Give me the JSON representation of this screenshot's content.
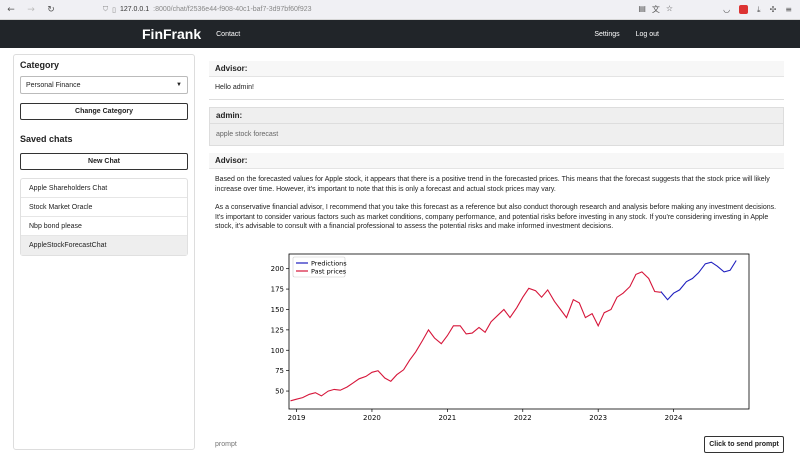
{
  "browser": {
    "url_host": "127.0.0.1",
    "url_rest": ":8000/chat/f2536e44-f908-40c1-baf7-3d97bf60f923"
  },
  "navbar": {
    "brand": "FinFrank",
    "contact": "Contact",
    "settings": "Settings",
    "logout": "Log out"
  },
  "sidebar": {
    "category_title": "Category",
    "category_selected": "Personal Finance",
    "change_category": "Change Category",
    "saved_title": "Saved chats",
    "new_chat": "New Chat",
    "chats": [
      {
        "label": "Apple Shareholders Chat"
      },
      {
        "label": "Stock Market Oracle"
      },
      {
        "label": "Nbp bond please"
      },
      {
        "label": "AppleStockForecastChat"
      }
    ]
  },
  "messages": {
    "m1": {
      "sender": "Advisor:",
      "text": "Hello admin!"
    },
    "m2": {
      "sender": "admin:",
      "text": "apple stock forecast"
    },
    "m3": {
      "sender": "Advisor:",
      "p1": "Based on the forecasted values for Apple stock, it appears that there is a positive trend in the forecasted prices. This means that the forecast suggests that the stock price will likely increase over time. However, it's important to note that this is only a forecast and actual stock prices may vary.",
      "p2": "As a conservative financial advisor, I recommend that you take this forecast as a reference but also conduct thorough research and analysis before making any investment decisions. It's important to consider various factors such as market conditions, company performance, and potential risks before investing in any stock. If you're considering investing in Apple stock, it's advisable to consult with a financial professional to assess the potential risks and make informed investment decisions."
    }
  },
  "input": {
    "placeholder": "prompt",
    "send_label": "Click to send prompt"
  },
  "chart_data": {
    "type": "line",
    "xlim": [
      2018.9,
      2025.0
    ],
    "ylim": [
      28,
      218
    ],
    "yticks": [
      50,
      75,
      100,
      125,
      150,
      175,
      200
    ],
    "xticks": [
      2019,
      2020,
      2021,
      2022,
      2023,
      2024
    ],
    "legend_position": "top-left",
    "series": [
      {
        "name": "Predictions",
        "color": "#1f1fbf",
        "x": [
          2023.83,
          2023.92,
          2024.0,
          2024.08,
          2024.17,
          2024.25,
          2024.33,
          2024.42,
          2024.5,
          2024.58,
          2024.67,
          2024.75,
          2024.83
        ],
        "y": [
          172,
          162,
          170,
          174,
          184,
          188,
          195,
          206,
          208,
          203,
          196,
          198,
          210
        ]
      },
      {
        "name": "Past prices",
        "color": "#d6163a",
        "x": [
          2018.92,
          2019.0,
          2019.08,
          2019.17,
          2019.25,
          2019.33,
          2019.42,
          2019.5,
          2019.58,
          2019.67,
          2019.75,
          2019.83,
          2019.92,
          2020.0,
          2020.08,
          2020.17,
          2020.25,
          2020.33,
          2020.42,
          2020.5,
          2020.58,
          2020.67,
          2020.75,
          2020.83,
          2020.92,
          2021.0,
          2021.08,
          2021.17,
          2021.25,
          2021.33,
          2021.42,
          2021.5,
          2021.58,
          2021.67,
          2021.75,
          2021.83,
          2021.92,
          2022.0,
          2022.08,
          2022.17,
          2022.25,
          2022.33,
          2022.42,
          2022.5,
          2022.58,
          2022.67,
          2022.75,
          2022.83,
          2022.92,
          2023.0,
          2023.08,
          2023.17,
          2023.25,
          2023.33,
          2023.42,
          2023.5,
          2023.58,
          2023.67,
          2023.75,
          2023.83
        ],
        "y": [
          38,
          40,
          42,
          46,
          48,
          44,
          50,
          52,
          51,
          55,
          60,
          65,
          68,
          73,
          75,
          66,
          62,
          70,
          76,
          88,
          98,
          112,
          125,
          115,
          108,
          118,
          130,
          130,
          120,
          121,
          128,
          122,
          135,
          143,
          150,
          140,
          152,
          165,
          176,
          173,
          165,
          174,
          160,
          150,
          140,
          162,
          158,
          140,
          145,
          130,
          146,
          150,
          165,
          170,
          178,
          193,
          196,
          188,
          172,
          171
        ]
      }
    ]
  }
}
